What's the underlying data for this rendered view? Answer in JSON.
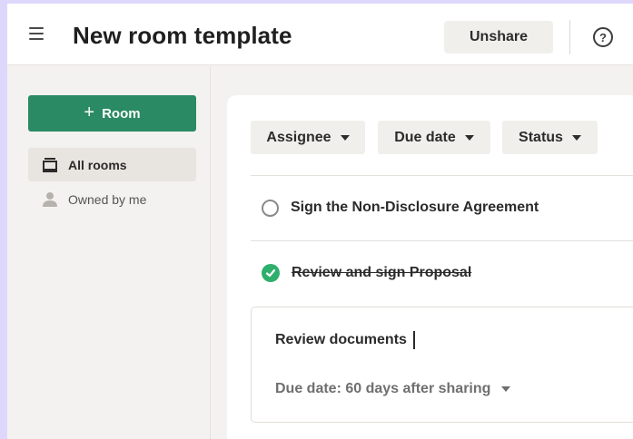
{
  "header": {
    "title": "New room template",
    "unshare_label": "Unshare",
    "help_symbol": "?"
  },
  "sidebar": {
    "new_room_label": "Room",
    "new_room_icon": "plus-icon",
    "items": [
      {
        "label": "All rooms",
        "icon": "rooms-stack-icon",
        "active": true
      },
      {
        "label": "Owned by me",
        "icon": "person-icon",
        "active": false
      }
    ]
  },
  "filters": [
    {
      "label": "Assignee"
    },
    {
      "label": "Due date"
    },
    {
      "label": "Status"
    }
  ],
  "tasks": [
    {
      "label": "Sign the Non-Disclosure Agreement",
      "completed": false
    },
    {
      "label": "Review and sign Proposal",
      "completed": true
    }
  ],
  "editing_task": {
    "value": "Review documents",
    "due_date_label": "Due date: 60 days after sharing"
  },
  "colors": {
    "primary_green": "#2a8a63",
    "check_green": "#2faf6c",
    "background": "#f4f2f0"
  }
}
